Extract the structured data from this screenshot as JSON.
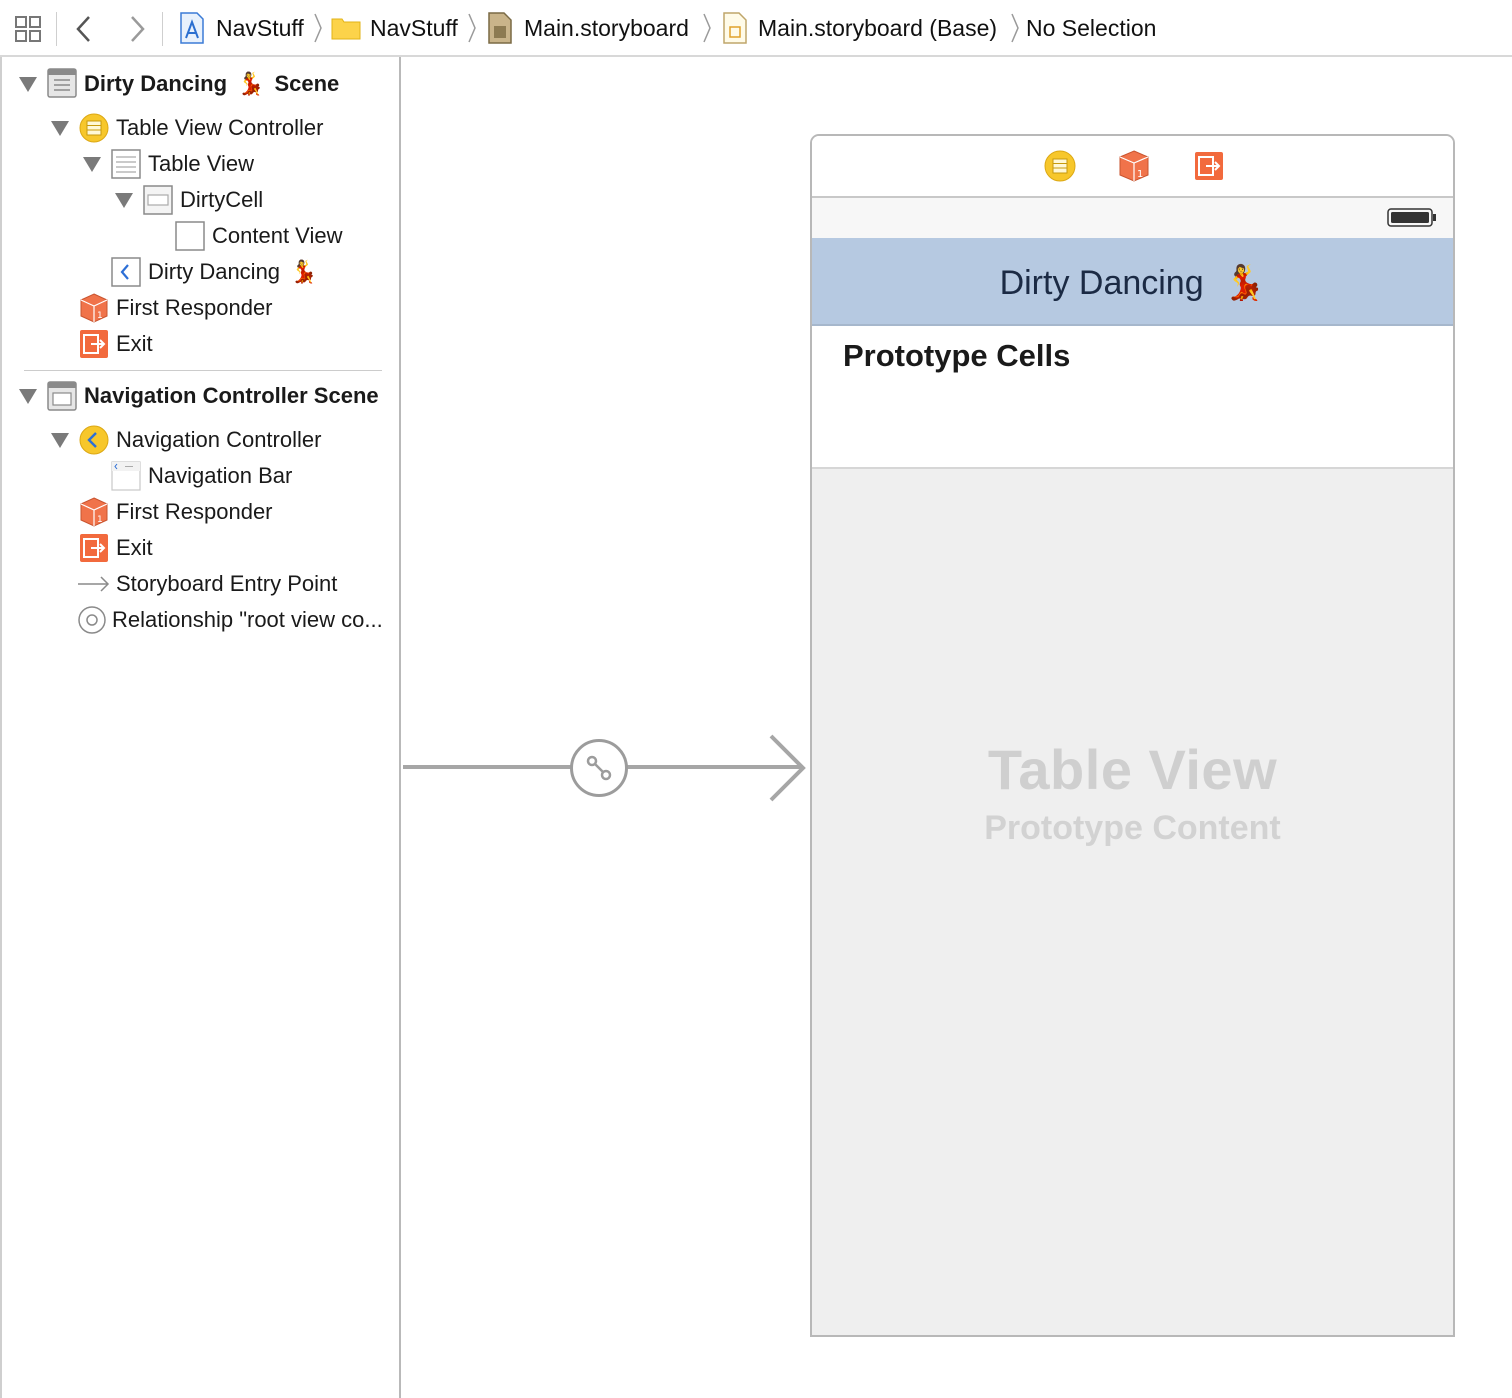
{
  "jumpbar": {
    "crumbs": [
      "NavStuff",
      "NavStuff",
      "Main.storyboard",
      "Main.storyboard (Base)",
      "No Selection"
    ],
    "icons": [
      "related-items-icon",
      "back-arrow-icon",
      "forward-arrow-icon",
      "xcode-project-icon",
      "folder-icon",
      "storyboard-file-icon",
      "storyboard-base-icon"
    ]
  },
  "outline": {
    "scene1": {
      "title": "Dirty Dancing",
      "emoji": "💃",
      "suffix": "Scene",
      "items": {
        "table_view_controller": "Table View Controller",
        "table_view": "Table View",
        "dirty_cell": "DirtyCell",
        "content_view": "Content View",
        "nav_item": "Dirty Dancing",
        "nav_item_emoji": "💃",
        "first_responder": "First Responder",
        "exit": "Exit"
      }
    },
    "scene2": {
      "title": "Navigation Controller Scene",
      "items": {
        "navigation_controller": "Navigation Controller",
        "navigation_bar": "Navigation Bar",
        "first_responder": "First Responder",
        "exit": "Exit",
        "entry_point": "Storyboard Entry Point",
        "relationship": "Relationship \"root view co..."
      }
    }
  },
  "canvas": {
    "nav_title": "Dirty Dancing",
    "nav_title_emoji": "💃",
    "prototype_cells": "Prototype Cells",
    "table_view_title": "Table View",
    "table_view_subtitle": "Prototype Content"
  },
  "colors": {
    "nav_bar": "#b6c9e1",
    "controller_yellow": "#f7c72b",
    "responder_orange": "#f0734a",
    "exit_orange": "#f26a3d",
    "chevron_blue": "#2d6fd6"
  }
}
